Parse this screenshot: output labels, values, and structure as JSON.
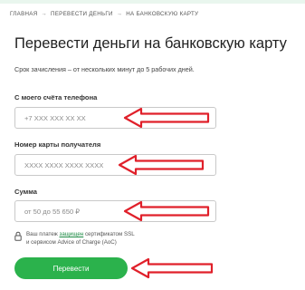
{
  "breadcrumb": {
    "items": [
      "ГЛАВНАЯ",
      "ПЕРЕВЕСТИ ДЕНЬГИ",
      "НА БАНКОВСКУЮ КАРТУ"
    ],
    "separator": "→"
  },
  "page": {
    "title": "Перевести деньги на банковскую карту",
    "subtitle": "Срок зачисления – от нескольких минут до 5 рабочих дней."
  },
  "form": {
    "phone": {
      "label": "С моего счёта телефона",
      "placeholder": "+7 XXX XXX XX XX"
    },
    "card": {
      "label": "Номер карты получателя",
      "placeholder": "XXXX XXXX XXXX XXXX"
    },
    "amount": {
      "label": "Сумма",
      "placeholder": "от 50 до 55 650 ₽"
    }
  },
  "security": {
    "line1_prefix": "Ваш платеж ",
    "line1_link": "защищен",
    "line1_suffix": " сертификатом SSL",
    "line2": "и сервисом Advice of Charge (AoC)"
  },
  "submit": {
    "label": "Перевести"
  },
  "colors": {
    "accent": "#2bb24c",
    "arrow": "#e0202a",
    "link": "#1b8a43"
  },
  "icons": {
    "lock": "lock-icon",
    "arrow": "red-arrow-annotation"
  }
}
